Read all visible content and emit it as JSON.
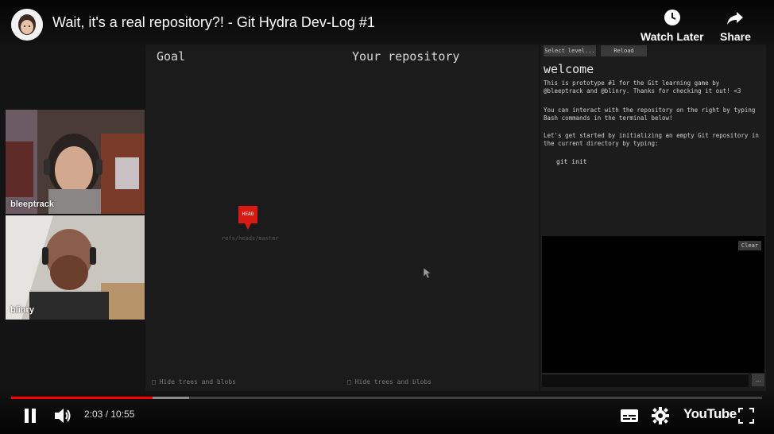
{
  "video": {
    "title": "Wait, it's a real repository?! - Git Hydra Dev-Log #1"
  },
  "top_actions": {
    "watch_later": "Watch Later",
    "share": "Share"
  },
  "webcams": [
    {
      "name": "bleeptrack"
    },
    {
      "name": "blinry"
    }
  ],
  "game": {
    "goal_title": "Goal",
    "repo_title": "Your repository",
    "hide_trees_left": "Hide trees and blobs",
    "hide_trees_right": "Hide trees and blobs",
    "head_label": "HEAD",
    "head_ref": "refs/heads/master"
  },
  "sidebar": {
    "select_level": "Select level...",
    "reload": "Reload",
    "heading": "welcome",
    "paragraphs": [
      "This is prototype #1 for the Git learning game by @bleeptrack and @blinry. Thanks for checking it out! <3",
      "You can interact with the repository on the right by typing Bash commands in the terminal below!",
      "Let's get started by initializing an empty Git repository in the current directory by typing:"
    ],
    "command": "git init",
    "clear": "Clear",
    "dots": "..."
  },
  "player": {
    "time_current": "2:03",
    "time_separator": " / ",
    "time_total": "10:55",
    "played_fraction": 0.188,
    "buffered_fraction": 0.237,
    "brand": "YouTube",
    "accent_color": "#ff0000"
  }
}
